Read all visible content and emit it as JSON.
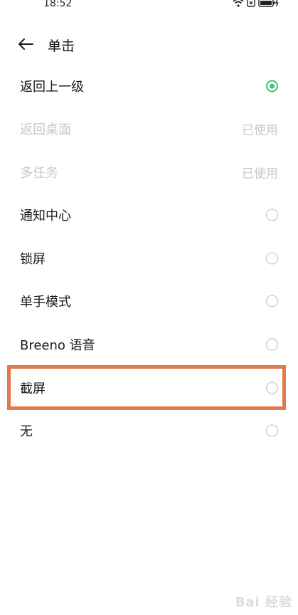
{
  "status_bar": {
    "time": "18:52"
  },
  "header": {
    "title": "单击"
  },
  "options": [
    {
      "label": "返回上一级",
      "state": "selected"
    },
    {
      "label": "返回桌面",
      "state": "used",
      "used_label": "已使用"
    },
    {
      "label": "多任务",
      "state": "used",
      "used_label": "已使用"
    },
    {
      "label": "通知中心",
      "state": "unselected"
    },
    {
      "label": "锁屏",
      "state": "unselected"
    },
    {
      "label": "单手模式",
      "state": "unselected"
    },
    {
      "label": "Breeno 语音",
      "state": "unselected"
    },
    {
      "label": "截屏",
      "state": "unselected",
      "highlighted": true
    },
    {
      "label": "无",
      "state": "unselected"
    }
  ],
  "watermark": "Bai 经验",
  "colors": {
    "accent": "#3cc27a",
    "highlight_border": "#e07a4a",
    "disabled_text": "#c8c8c8"
  }
}
